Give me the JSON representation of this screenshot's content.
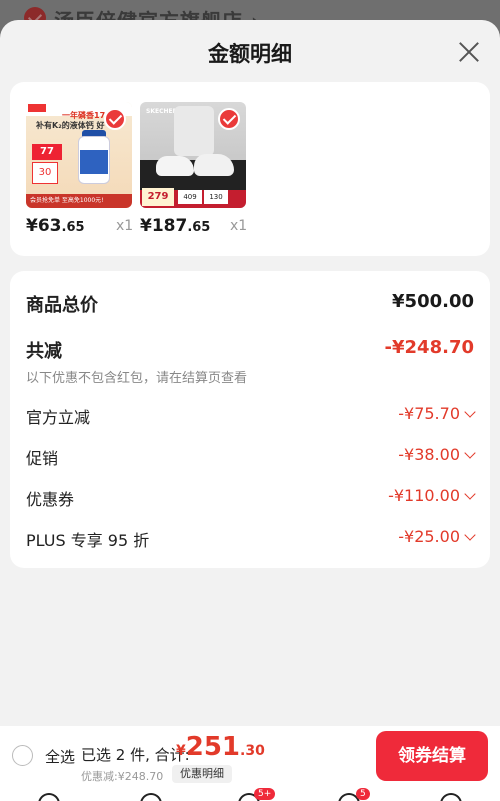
{
  "background": {
    "store_name": "汤臣倍健官方旗舰店 ›"
  },
  "sheet": {
    "title": "金额明细",
    "close_icon": "close-icon"
  },
  "products": [
    {
      "price_main": "¥63",
      "price_decimal": ".65",
      "qty": "x1",
      "image_banner": "一年磷香17.6",
      "image_tagline": "补有K₂的液体钙 好",
      "image_price": "77",
      "image_sub": "30",
      "image_footer": "会员抢免单 至高免1000元!"
    },
    {
      "price_main": "¥187",
      "price_decimal": ".65",
      "qty": "x1",
      "image_brand": "SKECHERS",
      "image_price": "279",
      "image_n1": "409",
      "image_n2": "130"
    }
  ],
  "summary": {
    "total_label": "商品总价",
    "total_value": "¥500.00",
    "reduce_label": "共减",
    "reduce_value": "-¥248.70",
    "note": "以下优惠不包含红包，请在结算页查看",
    "items": [
      {
        "label": "官方立减",
        "value": "-¥75.70"
      },
      {
        "label": "促销",
        "value": "-¥38.00"
      },
      {
        "label": "优惠券",
        "value": "-¥110.00"
      },
      {
        "label": "PLUS 专享 95 折",
        "value": "-¥25.00"
      }
    ]
  },
  "bottom": {
    "select_all": "全选",
    "selected_count": "已选 2 件, 合计:",
    "total_currency": "¥",
    "total_int": "251",
    "total_dec": ".30",
    "discount_line": "优惠减:¥248.70",
    "detail_label": "优惠明细",
    "checkout_label": "领券结算"
  },
  "tabbar": {
    "badge_messages": "5+",
    "badge_cart": "5"
  },
  "colors": {
    "accent_red": "#ef2a3a",
    "price_red": "#e23a2a"
  }
}
